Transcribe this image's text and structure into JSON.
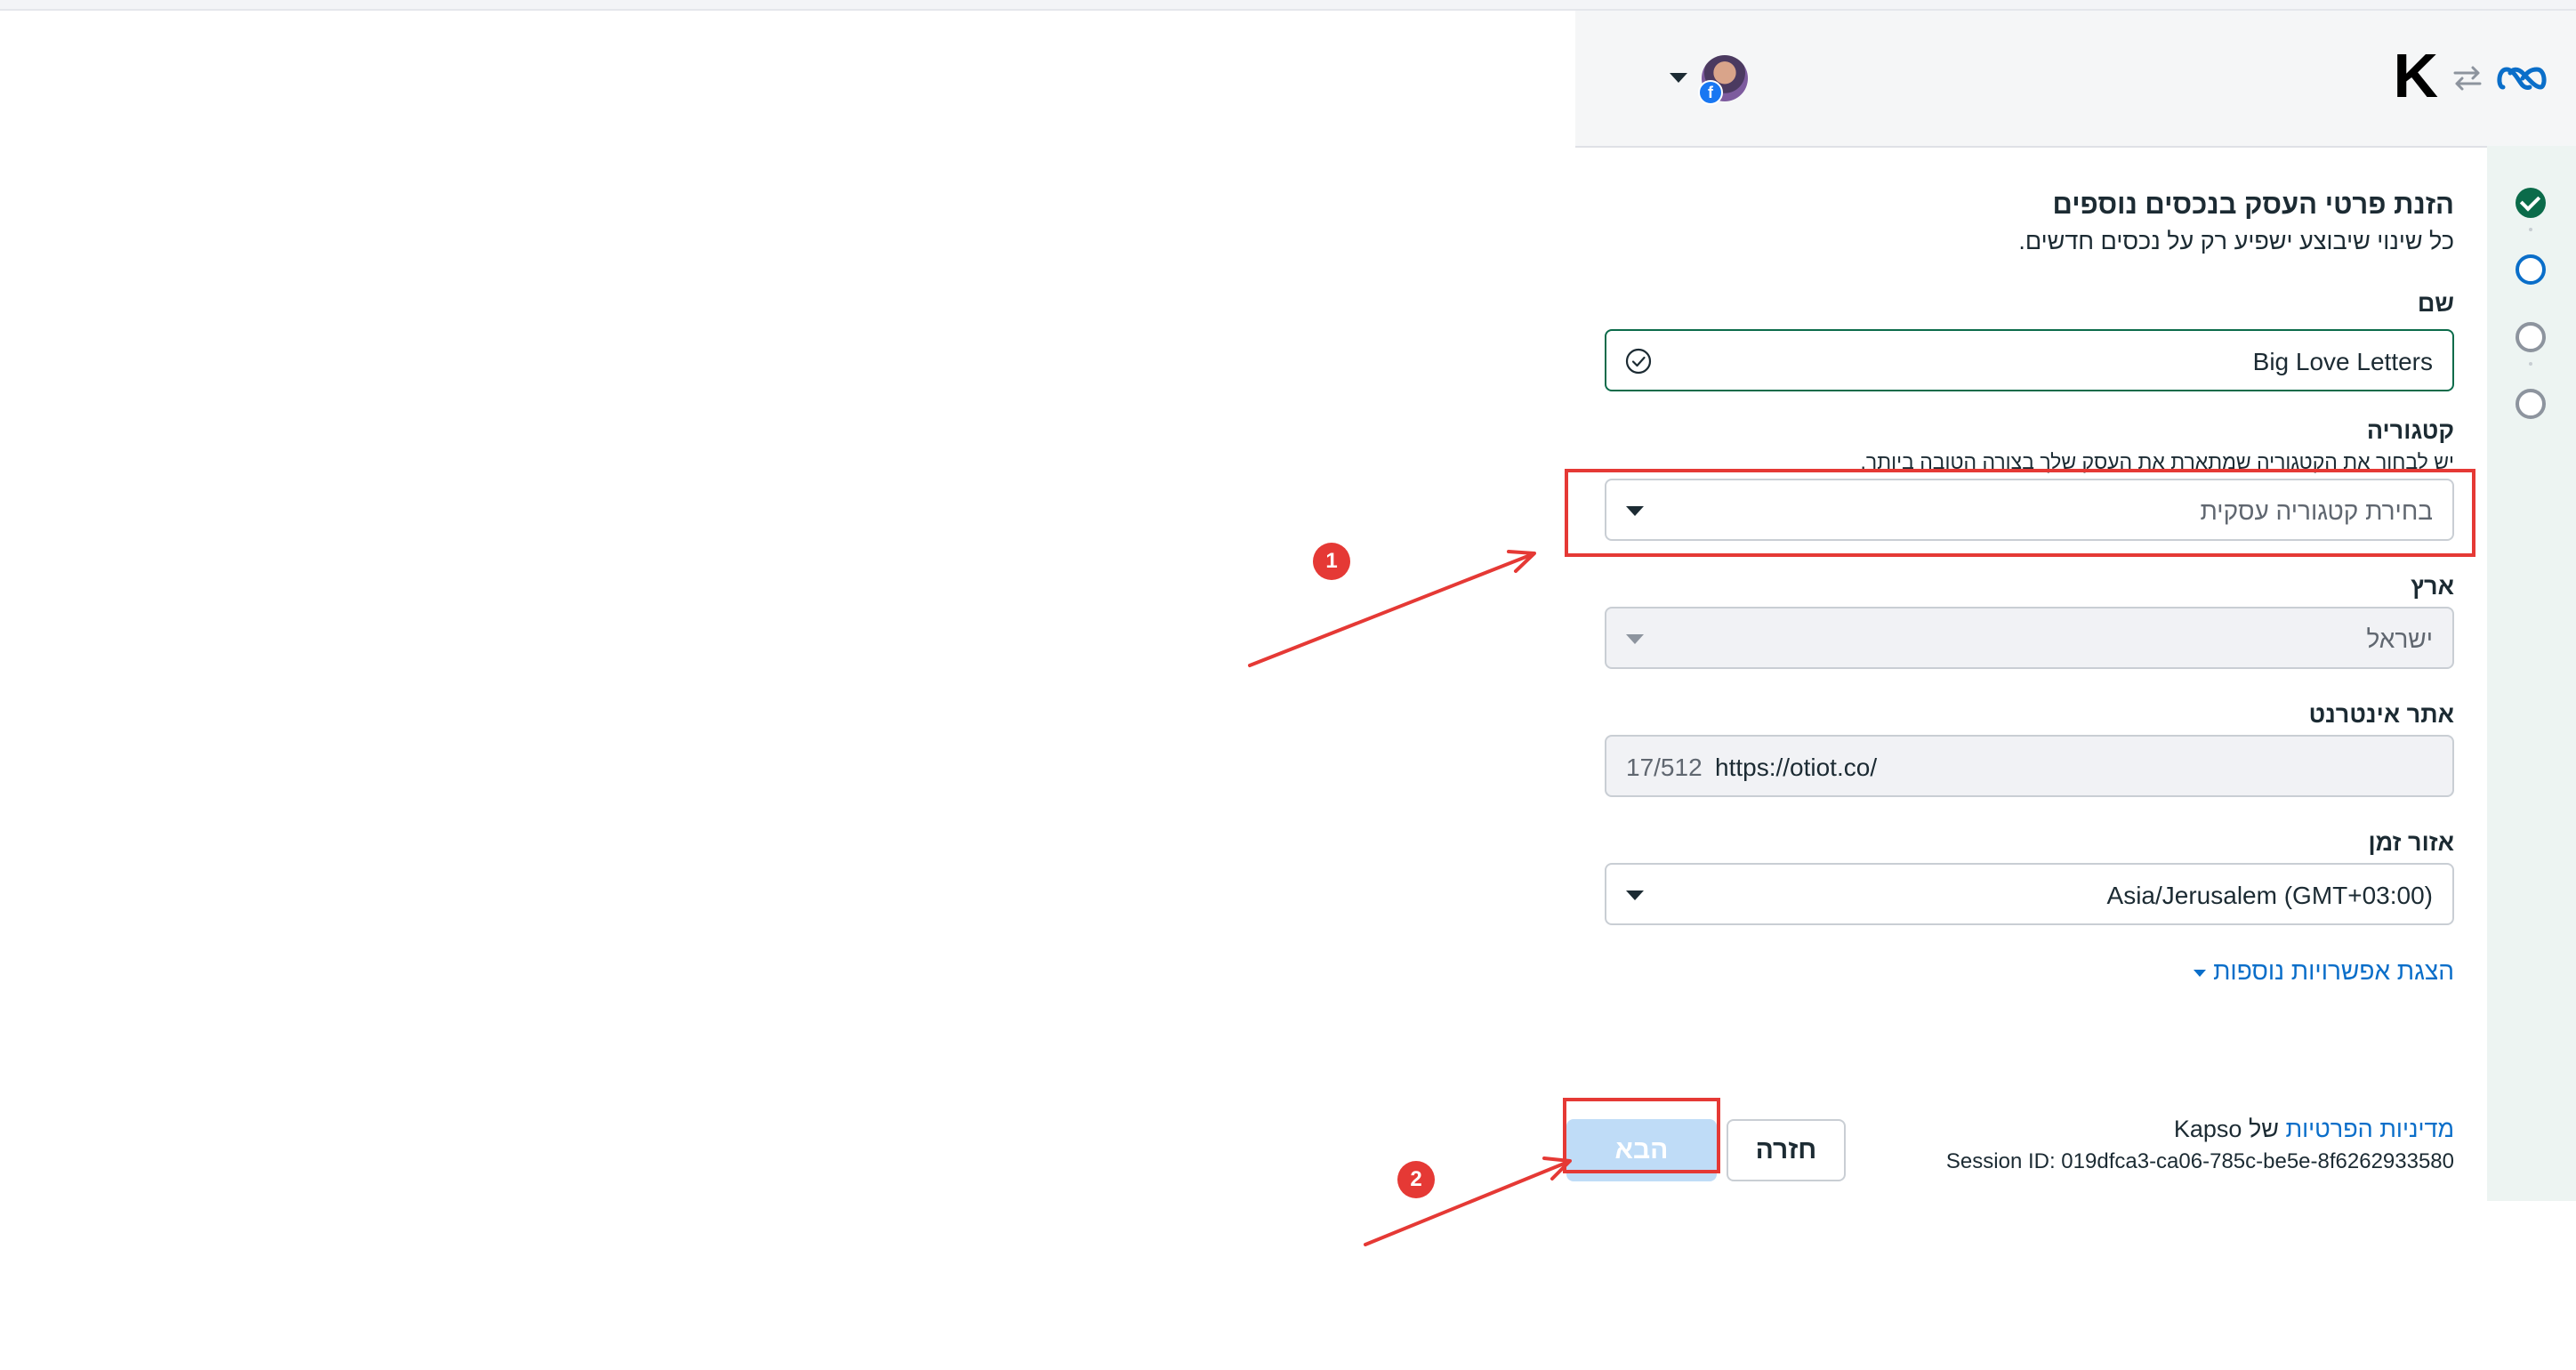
{
  "header": {
    "brand_letter": "K",
    "icons": [
      "swap-arrows-icon",
      "meta-logo-icon",
      "facebook-icon"
    ],
    "account_caret": "chevron-down-icon"
  },
  "steps": [
    {
      "state": "done"
    },
    {
      "state": "current"
    },
    {
      "state": "todo"
    },
    {
      "state": "todo"
    }
  ],
  "form": {
    "title": "הזנת פרטי העסק בנכסים נוספים",
    "subtitle": "כל שינוי שיבוצע ישפיע רק על נכסים חדשים.",
    "name": {
      "label": "שם",
      "value": "Big Love Letters"
    },
    "category": {
      "label": "קטגוריה",
      "help": "יש לבחור את הקטגוריה שמתארת את העסק שלך בצורה הטובה ביותר.",
      "placeholder": "בחירת קטגוריה עסקית"
    },
    "country": {
      "label": "ארץ",
      "value": "ישראל"
    },
    "website": {
      "label": "אתר אינטרנט",
      "value": "https://otiot.co/",
      "counter": "17/512"
    },
    "timezone": {
      "label": "אזור זמן",
      "value": "Asia/Jerusalem (GMT+03:00)"
    },
    "more_options": "הצגת אפשרויות נוספות"
  },
  "footer": {
    "privacy_link": "מדיניות הפרטיות",
    "privacy_of": "של Kapso",
    "session_id": "Session ID: 019dfca3-ca06-785c-be5e-8f6262933580",
    "back_label": "חזרה",
    "next_label": "הבא"
  },
  "annotations": {
    "badge_1": "1",
    "badge_2": "2",
    "color": "#e53935"
  },
  "colors": {
    "accent": "#0a6ec9",
    "success": "#0b6b4a",
    "next_disabled": "#bfdcf7"
  }
}
